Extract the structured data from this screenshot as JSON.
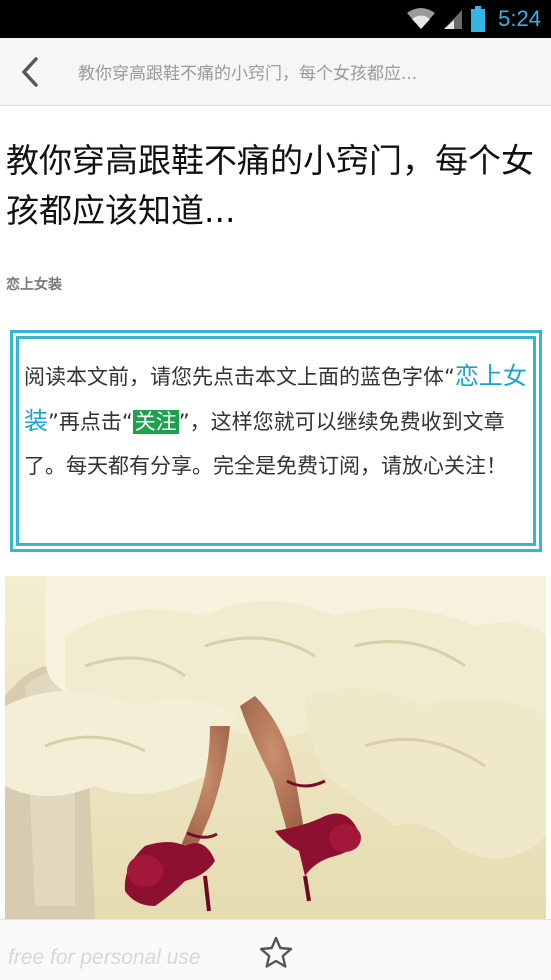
{
  "status_bar": {
    "time": "5:24",
    "icons": [
      "wifi-icon",
      "signal-icon",
      "battery-icon"
    ],
    "time_color": "#33b5e5"
  },
  "toolbar": {
    "back_icon": "chevron-left-icon",
    "title": "教你穿高跟鞋不痛的小窍门，每个女孩都应..."
  },
  "article": {
    "title": "教你穿高跟鞋不痛的小窍门，每个女孩都应该知道...",
    "author": "恋上女装",
    "notice": {
      "part1": "阅读本文前，请您先点击本文上面的蓝色字体“",
      "link_text": "恋上女装",
      "part2": "”再点击“",
      "follow_text": "关注",
      "part3": "”，这样您就可以继续免费收到文章了。每天都有分享。完全是免费订阅，请放心关注！"
    },
    "image_icon": "wedding-dress-red-heels-photo"
  },
  "bottom_bar": {
    "watermark": "free for personal use",
    "star_icon": "star-outline-icon"
  },
  "colors": {
    "accent_blue": "#35b6d3",
    "link_blue": "#1aa3cf",
    "follow_green": "#1ea14a"
  }
}
